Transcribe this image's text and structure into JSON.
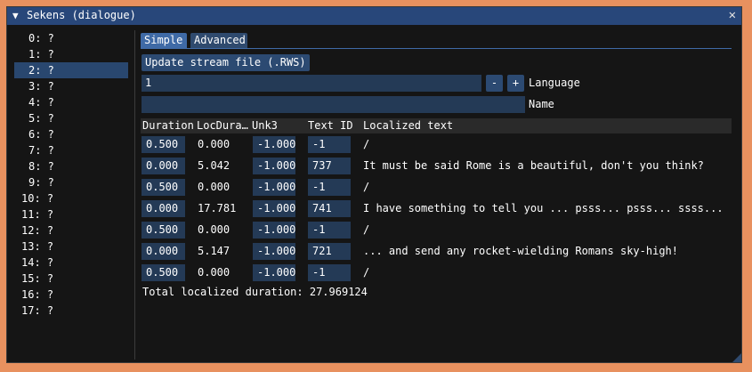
{
  "window": {
    "title": "Sekens (dialogue)",
    "collapse_icon": "▼",
    "close_icon": "✕"
  },
  "left_list": {
    "selected_index": 2,
    "items": [
      "0: ?",
      "1: ?",
      "2: ?",
      "3: ?",
      "4: ?",
      "5: ?",
      "6: ?",
      "7: ?",
      "8: ?",
      "9: ?",
      "10: ?",
      "11: ?",
      "12: ?",
      "13: ?",
      "14: ?",
      "15: ?",
      "16: ?",
      "17: ?"
    ]
  },
  "tabs": [
    {
      "label": "Simple",
      "active": true
    },
    {
      "label": "Advanced",
      "active": false
    }
  ],
  "update_button": "Update stream file (.RWS)",
  "language": {
    "value": "1",
    "minus": "-",
    "plus": "+",
    "label": "Language"
  },
  "name": {
    "value": "",
    "label": "Name"
  },
  "table": {
    "headers": [
      "Duration",
      "LocDura…",
      "Unk3",
      "Text ID",
      "Localized text"
    ],
    "rows": [
      {
        "duration": "0.500",
        "locdur": "0.000",
        "unk3": "-1.000",
        "text_id": "-1",
        "text": "/"
      },
      {
        "duration": "0.000",
        "locdur": "5.042",
        "unk3": "-1.000",
        "text_id": "737",
        "text": "It must be said Rome is a beautiful, don't you think?"
      },
      {
        "duration": "0.500",
        "locdur": "0.000",
        "unk3": "-1.000",
        "text_id": "-1",
        "text": "/"
      },
      {
        "duration": "0.000",
        "locdur": "17.781",
        "unk3": "-1.000",
        "text_id": "741",
        "text": "I have something to tell you ... psss... psss... ssss..."
      },
      {
        "duration": "0.500",
        "locdur": "0.000",
        "unk3": "-1.000",
        "text_id": "-1",
        "text": "/"
      },
      {
        "duration": "0.000",
        "locdur": "5.147",
        "unk3": "-1.000",
        "text_id": "721",
        "text": "... and send any rocket-wielding Romans sky-high!"
      },
      {
        "duration": "0.500",
        "locdur": "0.000",
        "unk3": "-1.000",
        "text_id": "-1",
        "text": "/"
      }
    ]
  },
  "total_label": "Total localized duration: 27.969124",
  "colors": {
    "titlebar": "#28477a",
    "background": "#151515",
    "field": "#243a56",
    "selected": "#29476f",
    "outer": "#e8915f"
  }
}
